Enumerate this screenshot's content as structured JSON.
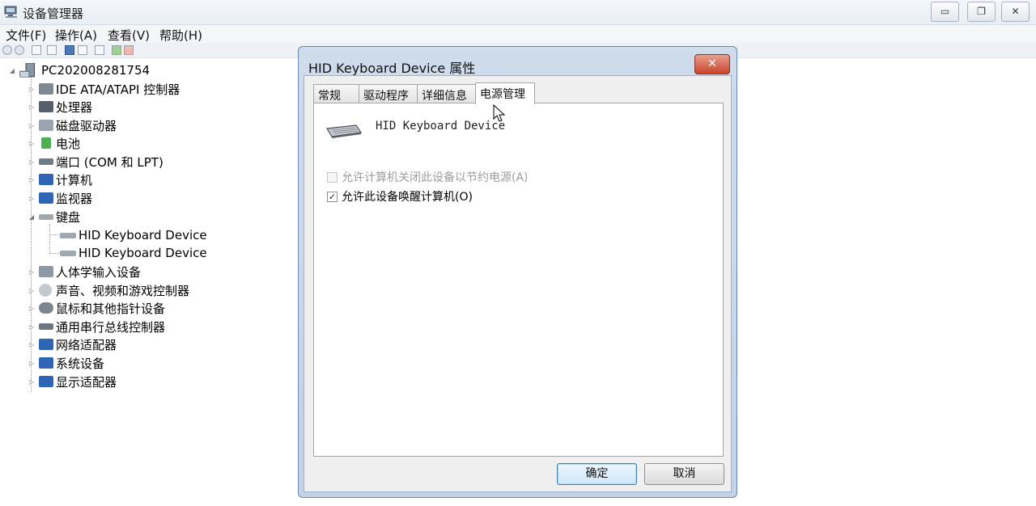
{
  "window": {
    "title": "设备管理器",
    "controls": {
      "minimize": "▭",
      "restore": "❐",
      "close": "✕"
    }
  },
  "menu": [
    "文件(F)",
    "操作(A)",
    "查看(V)",
    "帮助(H)"
  ],
  "tree": {
    "root": "PC202008281754",
    "categories": [
      {
        "label": "IDE ATA/ATAPI 控制器",
        "icon": "ide-controller-icon"
      },
      {
        "label": "处理器",
        "icon": "processor-icon"
      },
      {
        "label": "磁盘驱动器",
        "icon": "disk-drive-icon"
      },
      {
        "label": "电池",
        "icon": "battery-icon"
      },
      {
        "label": "端口 (COM 和 LPT)",
        "icon": "port-icon"
      },
      {
        "label": "计算机",
        "icon": "computer-icon"
      },
      {
        "label": "监视器",
        "icon": "monitor-icon"
      },
      {
        "label": "键盘",
        "icon": "keyboard-icon",
        "expanded": true,
        "children": [
          "HID Keyboard Device",
          "HID Keyboard Device"
        ]
      },
      {
        "label": "人体学输入设备",
        "icon": "hid-icon"
      },
      {
        "label": "声音、视频和游戏控制器",
        "icon": "sound-icon"
      },
      {
        "label": "鼠标和其他指针设备",
        "icon": "mouse-icon"
      },
      {
        "label": "通用串行总线控制器",
        "icon": "usb-icon"
      },
      {
        "label": "网络适配器",
        "icon": "network-icon"
      },
      {
        "label": "系统设备",
        "icon": "system-icon"
      },
      {
        "label": "显示适配器",
        "icon": "display-icon"
      }
    ]
  },
  "dialog": {
    "title": "HID Keyboard Device 属性",
    "close_label": "✕",
    "tabs": [
      "常规",
      "驱动程序",
      "详细信息",
      "电源管理"
    ],
    "active_tab": "电源管理",
    "device_name": "HID Keyboard Device",
    "options": [
      {
        "label": "允许计算机关闭此设备以节约电源(A)",
        "checked": false,
        "disabled": true
      },
      {
        "label": "允许此设备唤醒计算机(O)",
        "checked": true,
        "disabled": false
      }
    ],
    "check_mark": "✓",
    "ok_label": "确定",
    "cancel_label": "取消"
  },
  "colors": {
    "accent": "#3c7fb1",
    "close_red": "#c9452d"
  }
}
